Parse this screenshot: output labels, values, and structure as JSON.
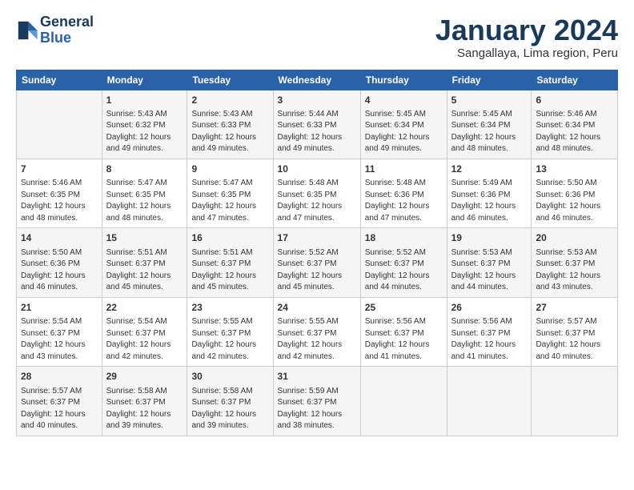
{
  "logo": {
    "line1": "General",
    "line2": "Blue"
  },
  "title": "January 2024",
  "subtitle": "Sangallaya, Lima region, Peru",
  "days_header": [
    "Sunday",
    "Monday",
    "Tuesday",
    "Wednesday",
    "Thursday",
    "Friday",
    "Saturday"
  ],
  "weeks": [
    [
      {
        "day": "",
        "info": ""
      },
      {
        "day": "1",
        "info": "Sunrise: 5:43 AM\nSunset: 6:32 PM\nDaylight: 12 hours\nand 49 minutes."
      },
      {
        "day": "2",
        "info": "Sunrise: 5:43 AM\nSunset: 6:33 PM\nDaylight: 12 hours\nand 49 minutes."
      },
      {
        "day": "3",
        "info": "Sunrise: 5:44 AM\nSunset: 6:33 PM\nDaylight: 12 hours\nand 49 minutes."
      },
      {
        "day": "4",
        "info": "Sunrise: 5:45 AM\nSunset: 6:34 PM\nDaylight: 12 hours\nand 49 minutes."
      },
      {
        "day": "5",
        "info": "Sunrise: 5:45 AM\nSunset: 6:34 PM\nDaylight: 12 hours\nand 48 minutes."
      },
      {
        "day": "6",
        "info": "Sunrise: 5:46 AM\nSunset: 6:34 PM\nDaylight: 12 hours\nand 48 minutes."
      }
    ],
    [
      {
        "day": "7",
        "info": "Sunrise: 5:46 AM\nSunset: 6:35 PM\nDaylight: 12 hours\nand 48 minutes."
      },
      {
        "day": "8",
        "info": "Sunrise: 5:47 AM\nSunset: 6:35 PM\nDaylight: 12 hours\nand 48 minutes."
      },
      {
        "day": "9",
        "info": "Sunrise: 5:47 AM\nSunset: 6:35 PM\nDaylight: 12 hours\nand 47 minutes."
      },
      {
        "day": "10",
        "info": "Sunrise: 5:48 AM\nSunset: 6:35 PM\nDaylight: 12 hours\nand 47 minutes."
      },
      {
        "day": "11",
        "info": "Sunrise: 5:48 AM\nSunset: 6:36 PM\nDaylight: 12 hours\nand 47 minutes."
      },
      {
        "day": "12",
        "info": "Sunrise: 5:49 AM\nSunset: 6:36 PM\nDaylight: 12 hours\nand 46 minutes."
      },
      {
        "day": "13",
        "info": "Sunrise: 5:50 AM\nSunset: 6:36 PM\nDaylight: 12 hours\nand 46 minutes."
      }
    ],
    [
      {
        "day": "14",
        "info": "Sunrise: 5:50 AM\nSunset: 6:36 PM\nDaylight: 12 hours\nand 46 minutes."
      },
      {
        "day": "15",
        "info": "Sunrise: 5:51 AM\nSunset: 6:37 PM\nDaylight: 12 hours\nand 45 minutes."
      },
      {
        "day": "16",
        "info": "Sunrise: 5:51 AM\nSunset: 6:37 PM\nDaylight: 12 hours\nand 45 minutes."
      },
      {
        "day": "17",
        "info": "Sunrise: 5:52 AM\nSunset: 6:37 PM\nDaylight: 12 hours\nand 45 minutes."
      },
      {
        "day": "18",
        "info": "Sunrise: 5:52 AM\nSunset: 6:37 PM\nDaylight: 12 hours\nand 44 minutes."
      },
      {
        "day": "19",
        "info": "Sunrise: 5:53 AM\nSunset: 6:37 PM\nDaylight: 12 hours\nand 44 minutes."
      },
      {
        "day": "20",
        "info": "Sunrise: 5:53 AM\nSunset: 6:37 PM\nDaylight: 12 hours\nand 43 minutes."
      }
    ],
    [
      {
        "day": "21",
        "info": "Sunrise: 5:54 AM\nSunset: 6:37 PM\nDaylight: 12 hours\nand 43 minutes."
      },
      {
        "day": "22",
        "info": "Sunrise: 5:54 AM\nSunset: 6:37 PM\nDaylight: 12 hours\nand 42 minutes."
      },
      {
        "day": "23",
        "info": "Sunrise: 5:55 AM\nSunset: 6:37 PM\nDaylight: 12 hours\nand 42 minutes."
      },
      {
        "day": "24",
        "info": "Sunrise: 5:55 AM\nSunset: 6:37 PM\nDaylight: 12 hours\nand 42 minutes."
      },
      {
        "day": "25",
        "info": "Sunrise: 5:56 AM\nSunset: 6:37 PM\nDaylight: 12 hours\nand 41 minutes."
      },
      {
        "day": "26",
        "info": "Sunrise: 5:56 AM\nSunset: 6:37 PM\nDaylight: 12 hours\nand 41 minutes."
      },
      {
        "day": "27",
        "info": "Sunrise: 5:57 AM\nSunset: 6:37 PM\nDaylight: 12 hours\nand 40 minutes."
      }
    ],
    [
      {
        "day": "28",
        "info": "Sunrise: 5:57 AM\nSunset: 6:37 PM\nDaylight: 12 hours\nand 40 minutes."
      },
      {
        "day": "29",
        "info": "Sunrise: 5:58 AM\nSunset: 6:37 PM\nDaylight: 12 hours\nand 39 minutes."
      },
      {
        "day": "30",
        "info": "Sunrise: 5:58 AM\nSunset: 6:37 PM\nDaylight: 12 hours\nand 39 minutes."
      },
      {
        "day": "31",
        "info": "Sunrise: 5:59 AM\nSunset: 6:37 PM\nDaylight: 12 hours\nand 38 minutes."
      },
      {
        "day": "",
        "info": ""
      },
      {
        "day": "",
        "info": ""
      },
      {
        "day": "",
        "info": ""
      }
    ]
  ]
}
